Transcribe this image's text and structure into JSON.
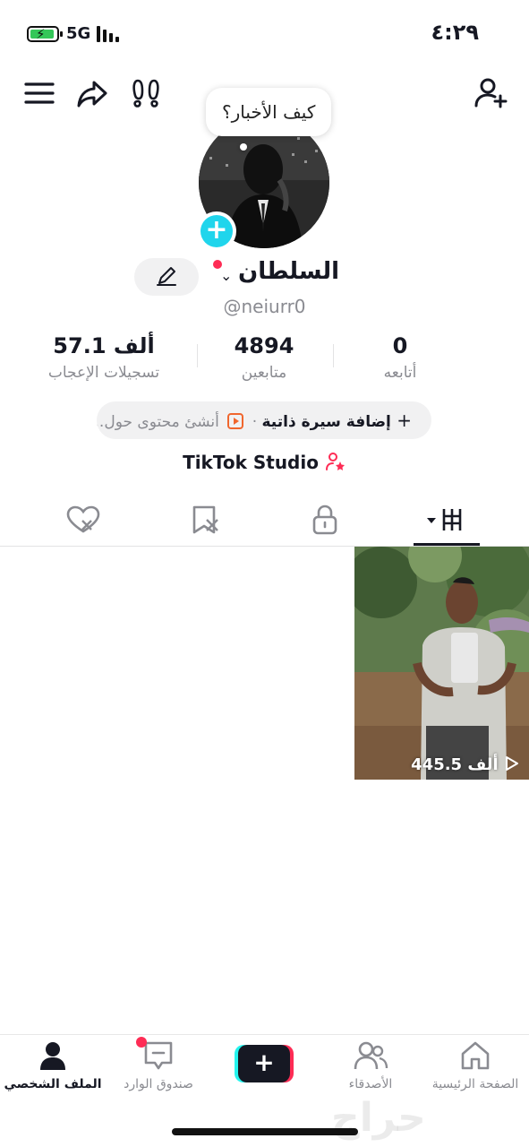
{
  "status_bar": {
    "time": "٤:٢٩",
    "network": "5G"
  },
  "profile": {
    "bubble_text": "كيف الأخبار؟",
    "display_name": "السلطان",
    "handle": "@neiurr0",
    "stats": [
      {
        "value": "0",
        "label": "أتابعه"
      },
      {
        "value": "4894",
        "label": "متابعين"
      },
      {
        "value": "57.1 ألف",
        "label": "تسجيلات الإعجاب"
      }
    ],
    "bio_add": "إضافة سيرة ذاتية",
    "bio_separator": "·",
    "bio_create": "أنشئ محتوى حول...",
    "studio": "TikTok Studio"
  },
  "videos": [
    {
      "views": "445.5 ألف"
    }
  ],
  "nav": {
    "home": "الصفحة الرئيسية",
    "friends": "الأصدقاء",
    "inbox": "صندوق الوارد",
    "profile": "الملف الشخصي"
  },
  "watermark": "حراج",
  "colors": {
    "accent": "#fe2c55",
    "cyan": "#25f4ee",
    "badge": "#20d5ec"
  }
}
